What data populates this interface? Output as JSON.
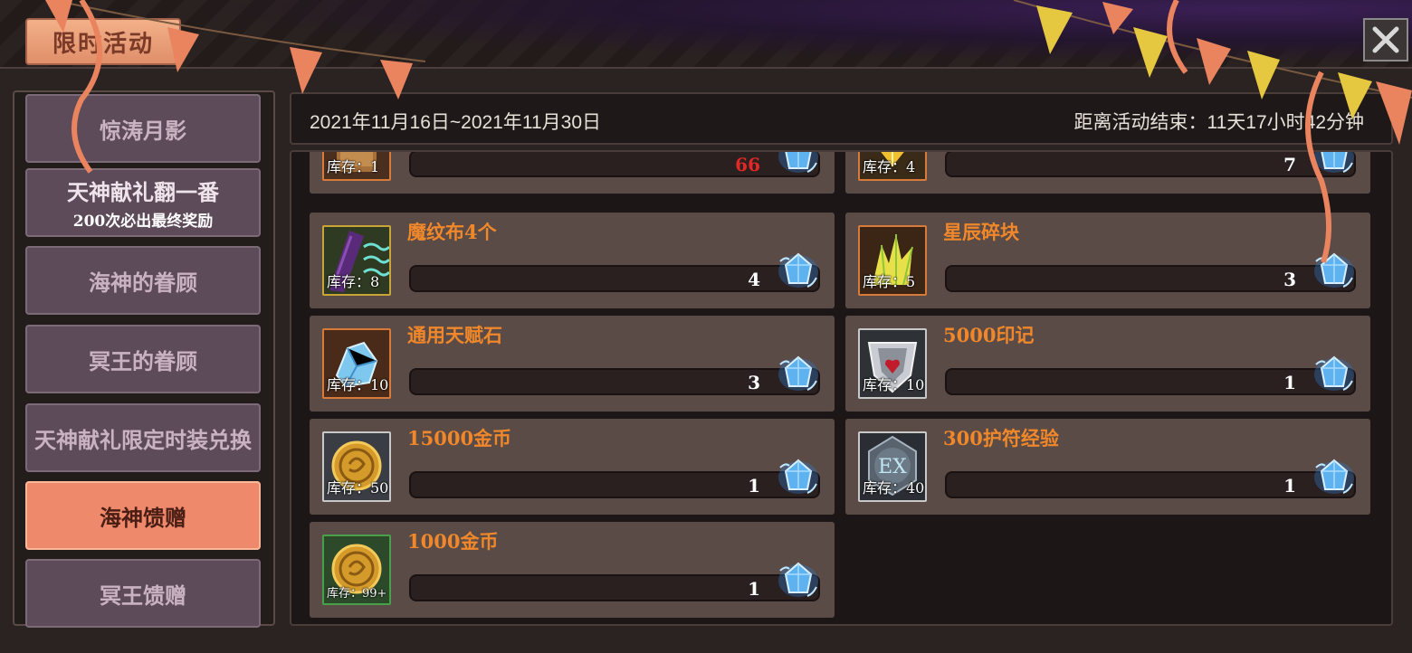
{
  "title": "限时活动",
  "sidebar": {
    "items": [
      {
        "label": "惊涛月影"
      },
      {
        "label": "天神献礼翻一番",
        "sub": "200次必出最终奖励"
      },
      {
        "label": "海神的眷顾"
      },
      {
        "label": "冥王的眷顾"
      },
      {
        "label": "天神献礼限定时装兑换"
      },
      {
        "label": "海神馈赠",
        "active": true
      },
      {
        "label": "冥王馈赠"
      }
    ]
  },
  "date_bar": {
    "range": "2021年11月16日~2021年11月30日",
    "countdown": "距离活动结束：11天17小时42分钟"
  },
  "items": [
    {
      "name": "",
      "stock": "库存：1",
      "cost": "66",
      "cost_color": "#e12828"
    },
    {
      "name": "",
      "stock": "库存：4",
      "cost": "7"
    },
    {
      "name": "魔纹布4个",
      "stock": "库存：8",
      "cost": "4"
    },
    {
      "name": "星辰碎块",
      "stock": "库存：5",
      "cost": "3"
    },
    {
      "name": "通用天赋石",
      "stock": "库存：10",
      "cost": "3"
    },
    {
      "name": "5000印记",
      "stock": "库存：10",
      "cost": "1"
    },
    {
      "name": "15000金币",
      "stock": "库存：50",
      "cost": "1"
    },
    {
      "name": "300护符经验",
      "stock": "库存：40",
      "cost": "1"
    },
    {
      "name": "1000金币",
      "stock": "库存：99+",
      "cost": "1"
    }
  ],
  "icons": {
    "close": "close-icon",
    "currency": "blue-gem-icon"
  },
  "colors": {
    "accent": "#ee8a6b",
    "item_name": "#f0882b",
    "card_bg": "#5a4b46",
    "sidebar_item": "#5e4b5a"
  }
}
